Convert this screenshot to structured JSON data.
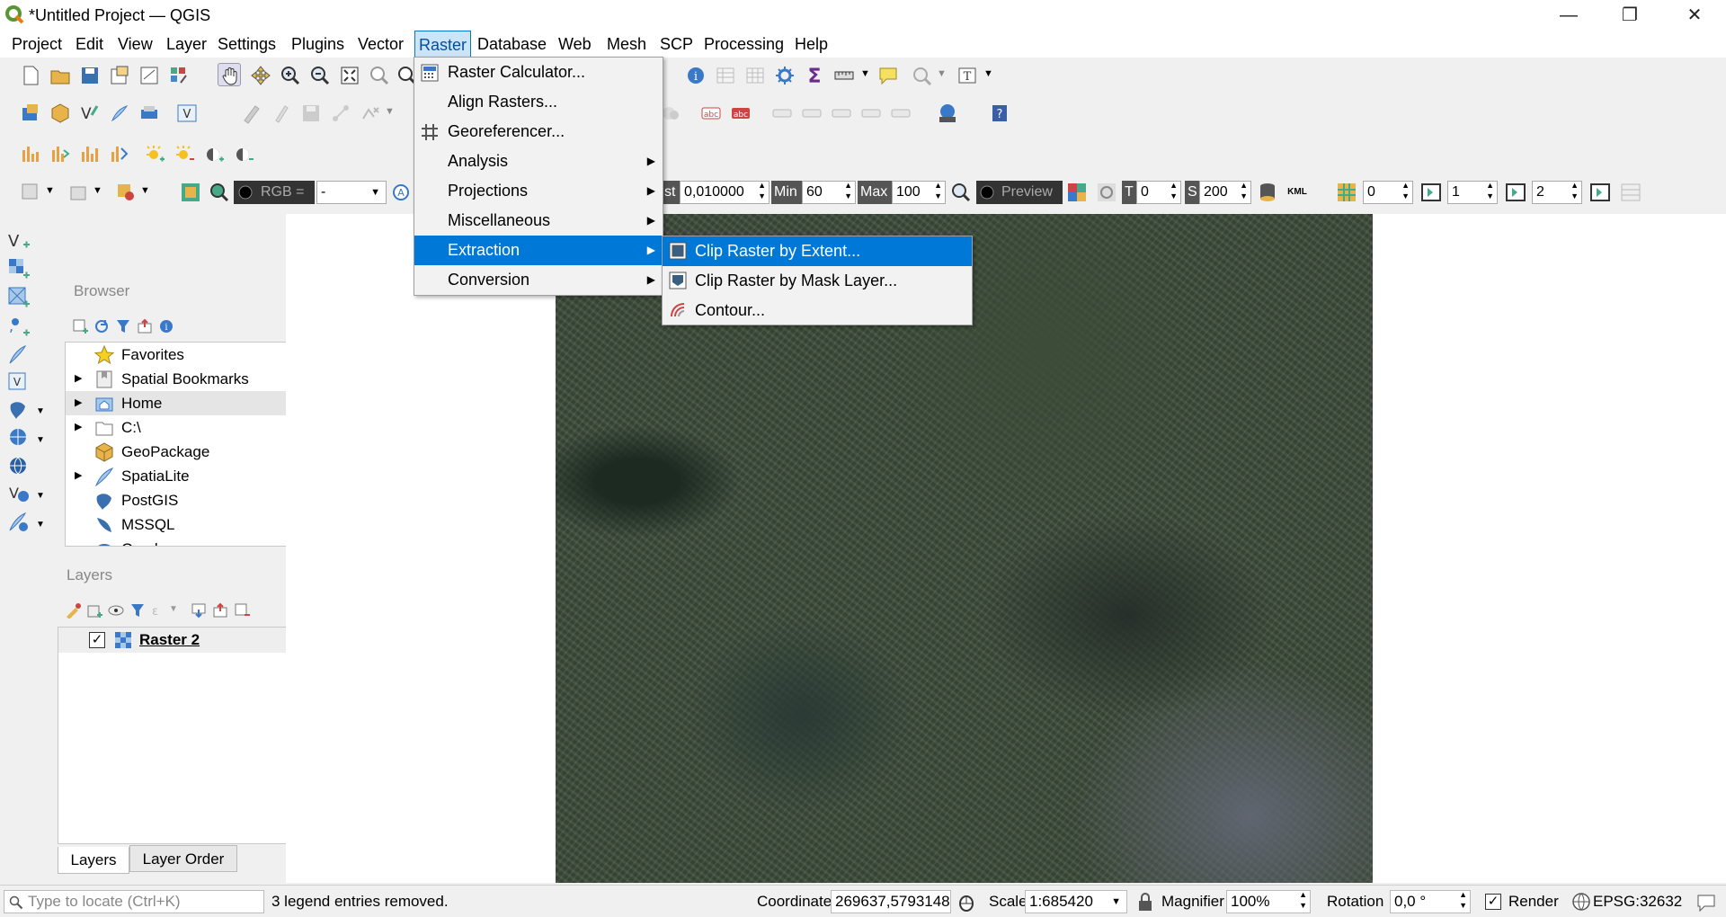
{
  "window": {
    "title": "*Untitled Project — QGIS",
    "minimize": "—",
    "restore": "❐",
    "close": "✕"
  },
  "menubar": [
    "Project",
    "Edit",
    "View",
    "Layer",
    "Settings",
    "Plugins",
    "Vector",
    "Raster",
    "Database",
    "Web",
    "Mesh",
    "SCP",
    "Processing",
    "Help"
  ],
  "raster_menu": {
    "items": [
      {
        "label": "Raster Calculator...",
        "icon": "raster-calculator-icon",
        "submenu": false
      },
      {
        "label": "Align Rasters...",
        "icon": "",
        "submenu": false
      },
      {
        "label": "Georeferencer...",
        "icon": "georeferencer-icon",
        "submenu": false
      },
      {
        "label": "Analysis",
        "icon": "",
        "submenu": true
      },
      {
        "label": "Projections",
        "icon": "",
        "submenu": true
      },
      {
        "label": "Miscellaneous",
        "icon": "",
        "submenu": true
      },
      {
        "label": "Extraction",
        "icon": "",
        "submenu": true,
        "highlighted": true
      },
      {
        "label": "Conversion",
        "icon": "",
        "submenu": true
      }
    ]
  },
  "extraction_menu": {
    "items": [
      {
        "label": "Clip Raster by Extent...",
        "icon": "clip-extent-icon",
        "highlighted": true
      },
      {
        "label": "Clip Raster by Mask Layer...",
        "icon": "clip-mask-icon"
      },
      {
        "label": "Contour...",
        "icon": "contour-icon"
      }
    ]
  },
  "scp_toolbar": {
    "st_label": "st",
    "st_value": "0,010000",
    "min_label": "Min",
    "min_value": "60",
    "max_label": "Max",
    "max_value": "100",
    "preview_label": "Preview",
    "t_label": "T",
    "t_value": "0",
    "s_label": "S",
    "s_value": "200",
    "kml_label": "KML",
    "band1": "0",
    "band2": "1",
    "band3": "2",
    "rgb_label": "RGB =",
    "rgb_value": "-"
  },
  "browser": {
    "title": "Browser",
    "items": [
      {
        "label": "Favorites",
        "icon": "favorites-icon",
        "expandable": false
      },
      {
        "label": "Spatial Bookmarks",
        "icon": "bookmarks-icon",
        "expandable": true
      },
      {
        "label": "Home",
        "icon": "home-icon",
        "expandable": true,
        "selected": true
      },
      {
        "label": "C:\\",
        "icon": "folder-icon",
        "expandable": true
      },
      {
        "label": "GeoPackage",
        "icon": "geopackage-icon",
        "expandable": false
      },
      {
        "label": "SpatiaLite",
        "icon": "spatialite-icon",
        "expandable": true
      },
      {
        "label": "PostGIS",
        "icon": "postgis-icon",
        "expandable": false
      },
      {
        "label": "MSSQL",
        "icon": "mssql-icon",
        "expandable": false
      },
      {
        "label": "Oracle",
        "icon": "oracle-icon",
        "expandable": false
      }
    ]
  },
  "layers": {
    "title": "Layers",
    "items": [
      {
        "label": "Raster 2",
        "checked": true
      }
    ],
    "tabs": [
      "Layers",
      "Layer Order"
    ]
  },
  "statusbar": {
    "locate_placeholder": "Type to locate (Ctrl+K)",
    "message": "3 legend entries removed.",
    "coordinate_label": "Coordinate",
    "coordinate": "269637,5793148",
    "scale_label": "Scale",
    "scale": "1:685420",
    "magnifier_label": "Magnifier",
    "magnifier": "100%",
    "rotation_label": "Rotation",
    "rotation": "0,0 °",
    "render_label": "Render",
    "epsg": "EPSG:32632"
  },
  "colors": {
    "accent": "#0078d7",
    "menu_open": "#cce4f7"
  }
}
